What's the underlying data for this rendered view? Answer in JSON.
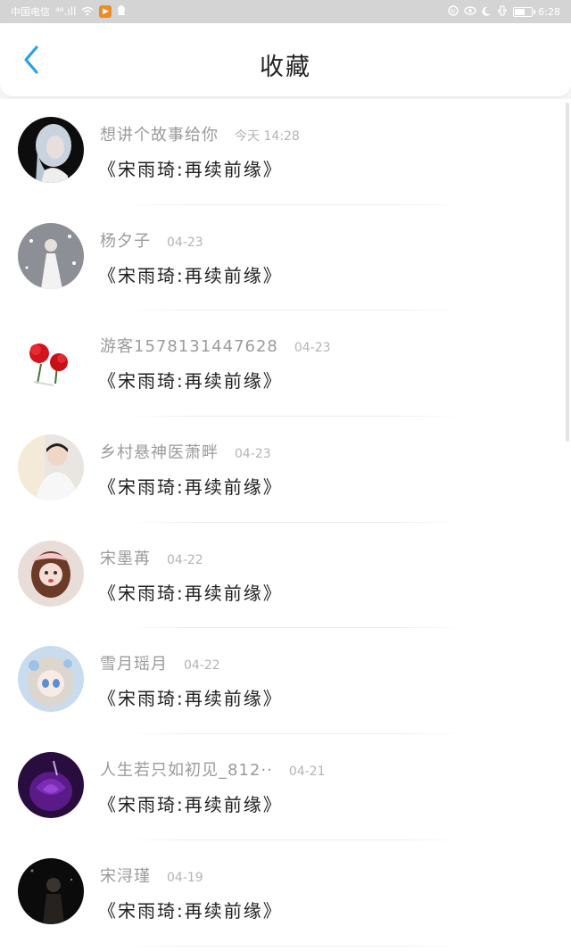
{
  "status_bar": {
    "carrier": "中国电信",
    "signal": "⁴⁶.ıll",
    "time": "6:28",
    "battery_level": 0.65
  },
  "header": {
    "title": "收藏",
    "back_icon": "chevron-left-icon",
    "accent": "#2aa0e6"
  },
  "favorites": [
    {
      "user": "想讲个故事给你",
      "time": "今天 14:28",
      "work": "《宋雨琦:再续前缘》",
      "avatar": "silver-hair-girl"
    },
    {
      "user": "杨夕子",
      "time": "04-23",
      "work": "《宋雨琦:再续前缘》",
      "avatar": "white-dress-snow"
    },
    {
      "user": "游客1578131447628",
      "time": "04-23",
      "work": "《宋雨琦:再续前缘》",
      "avatar": "red-carnations"
    },
    {
      "user": "乡村悬神医萧畔",
      "time": "04-23",
      "work": "《宋雨琦:再续前缘》",
      "avatar": "young-man"
    },
    {
      "user": "宋墨苒",
      "time": "04-22",
      "work": "《宋雨琦:再续前缘》",
      "avatar": "girl-pink-hat"
    },
    {
      "user": "雪月瑶月",
      "time": "04-22",
      "work": "《宋雨琦:再续前缘》",
      "avatar": "anime-girl"
    },
    {
      "user": "人生若只如初见_812··",
      "time": "04-21",
      "work": "《宋雨琦:再续前缘》",
      "avatar": "purple-rose"
    },
    {
      "user": "宋浔瑾",
      "time": "04-19",
      "work": "《宋雨琦:再续前缘》",
      "avatar": "dark-figure"
    }
  ]
}
